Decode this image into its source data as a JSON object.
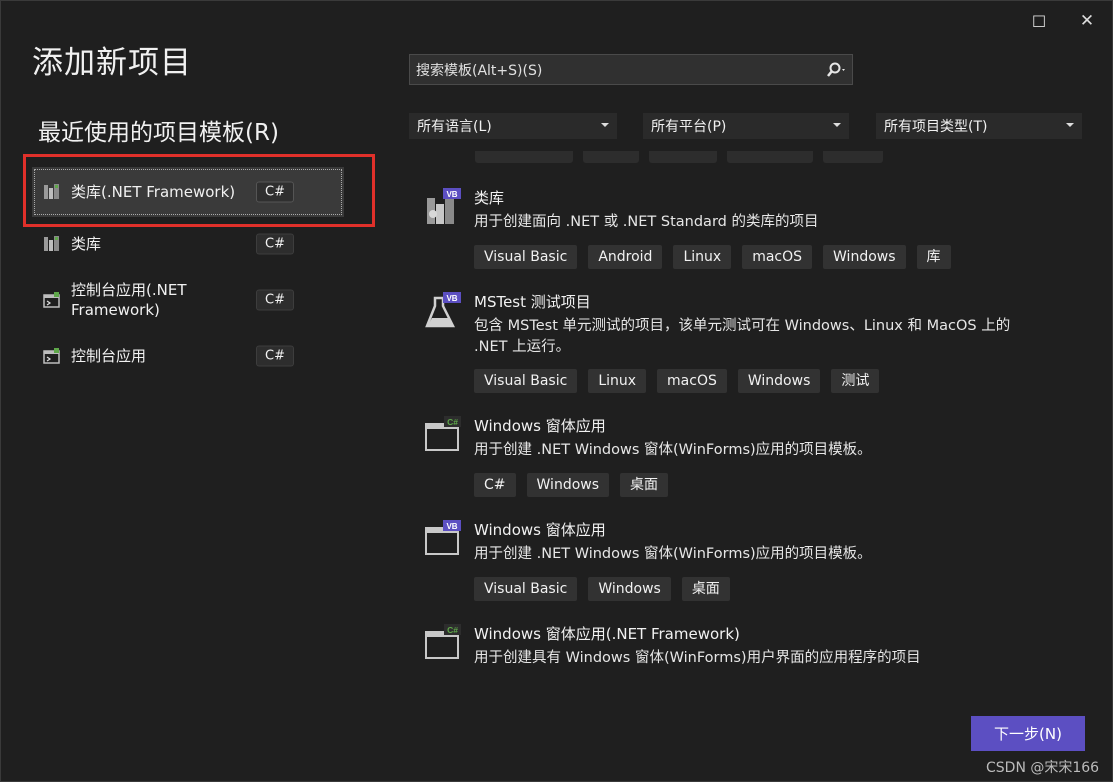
{
  "window": {
    "title": "添加新项目",
    "maximize_glyph": "☐",
    "close_glyph": "✕"
  },
  "recent": {
    "title": "最近使用的项目模板(R)",
    "items": [
      {
        "label": "类库(.NET Framework)",
        "badge": "C#",
        "icon": "class-library-icon",
        "selected": true
      },
      {
        "label": "类库",
        "badge": "C#",
        "icon": "class-library-icon",
        "selected": false
      },
      {
        "label": "控制台应用(.NET Framework)",
        "badge": "C#",
        "icon": "console-app-icon",
        "selected": false
      },
      {
        "label": "控制台应用",
        "badge": "C#",
        "icon": "console-app-icon",
        "selected": false
      }
    ]
  },
  "search": {
    "placeholder": "搜索模板(Alt+S)(S)",
    "icon": "search-icon"
  },
  "filters": {
    "language": "所有语言(L)",
    "platform": "所有平台(P)",
    "project_type": "所有项目类型(T)"
  },
  "templates": [
    {
      "name": "类库",
      "description": "用于创建面向 .NET 或 .NET Standard 的类库的项目",
      "icon": "vb-class-library-icon",
      "tags": [
        "Visual Basic",
        "Android",
        "Linux",
        "macOS",
        "Windows",
        "库"
      ]
    },
    {
      "name": "MSTest 测试项目",
      "description": "包含 MSTest 单元测试的项目，该单元测试可在 Windows、Linux 和 MacOS 上的 .NET 上运行。",
      "icon": "vb-test-flask-icon",
      "tags": [
        "Visual Basic",
        "Linux",
        "macOS",
        "Windows",
        "测试"
      ]
    },
    {
      "name": "Windows 窗体应用",
      "description": "用于创建 .NET Windows 窗体(WinForms)应用的项目模板。",
      "icon": "csharp-winforms-icon",
      "tags": [
        "C#",
        "Windows",
        "桌面"
      ]
    },
    {
      "name": "Windows 窗体应用",
      "description": "用于创建 .NET Windows 窗体(WinForms)应用的项目模板。",
      "icon": "vb-winforms-icon",
      "tags": [
        "Visual Basic",
        "Windows",
        "桌面"
      ]
    },
    {
      "name": "Windows 窗体应用(.NET Framework)",
      "description": "用于创建具有 Windows 窗体(WinForms)用户界面的应用程序的项目",
      "icon": "csharp-winforms-icon",
      "tags": []
    }
  ],
  "buttons": {
    "next": "下一步(N)"
  },
  "watermark": "CSDN @宋宋166",
  "colors": {
    "accent": "#5c4fc2",
    "highlight_box": "#e0302a",
    "background": "#1f1f1f"
  }
}
